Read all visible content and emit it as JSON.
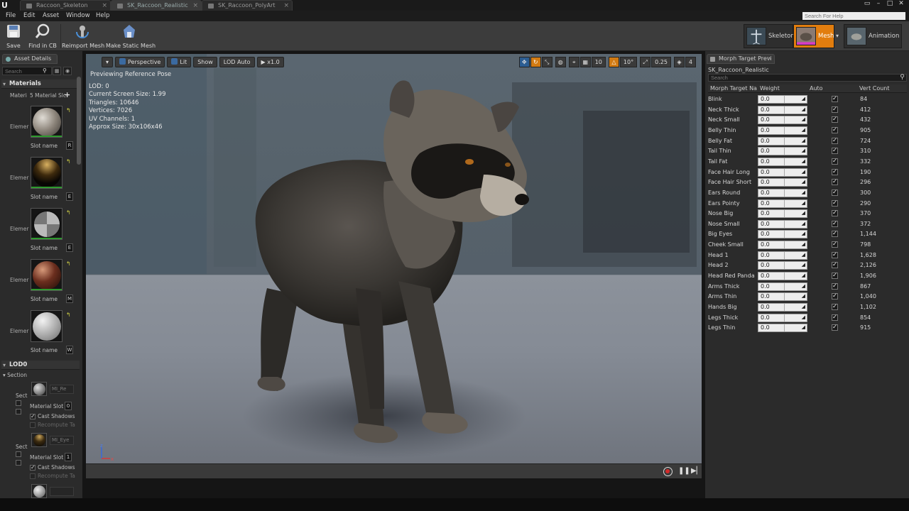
{
  "tabs": [
    {
      "label": "Raccoon_Skeleton",
      "active": false
    },
    {
      "label": "SK_Raccoon_Realistic",
      "active": true
    },
    {
      "label": "SK_Raccoon_PolyArt",
      "active": false
    }
  ],
  "menu": {
    "items": [
      "File",
      "Edit",
      "Asset",
      "Window",
      "Help"
    ],
    "help_search_placeholder": "Search For Help"
  },
  "toolbar": {
    "buttons": [
      {
        "label": "Save",
        "icon": "save-icon"
      },
      {
        "label": "Find in CB",
        "icon": "magnifier-icon"
      },
      {
        "label": "Reimport Mesh",
        "icon": "reimport-icon"
      },
      {
        "label": "Make Static Mesh",
        "icon": "static-mesh-icon"
      }
    ],
    "modes": [
      {
        "label": "Skeleton",
        "active": false
      },
      {
        "label": "Mesh",
        "active": true
      },
      {
        "label": "Animation",
        "active": false
      }
    ]
  },
  "asset_details": {
    "tab_label": "Asset Details",
    "search_placeholder": "Search",
    "materials_header": "Materials",
    "material_slots_label": "Materi",
    "material_slots_count": "5 Material Slc",
    "element_label": "Elemer",
    "slot_name_label": "Slot name",
    "slot_values": [
      "R",
      "E",
      "E",
      "M",
      "W"
    ],
    "lod_header": "LOD0",
    "sections_header": "Section",
    "section_label": "Sect",
    "material_slot_label": "Material Slot",
    "cast_shadows_label": "Cast Shadows",
    "recompute_label": "Recompute Ta",
    "section_materials": [
      "MI_Re",
      "MI_Eye"
    ],
    "section_slot_values": [
      "0",
      "1"
    ]
  },
  "viewport": {
    "buttons": {
      "perspective": "Perspective",
      "lit": "Lit",
      "show": "Show",
      "lod": "LOD Auto",
      "speed": "x1.0"
    },
    "right_values": {
      "grid": "10",
      "angle": "10°",
      "scale": "0.25",
      "cam": "4"
    },
    "title": "Previewing Reference Pose",
    "stats": {
      "lod": "LOD: 0",
      "screen_size": "Current Screen Size: 1.99",
      "triangles": "Triangles: 10646",
      "vertices": "Vertices: 7026",
      "uv_channels": "UV Channels: 1",
      "approx_size": "Approx Size: 30x106x46"
    }
  },
  "morph_panel": {
    "tab_label": "Morph Target Previ",
    "asset_name": "SK_Raccoon_Realistic",
    "search_placeholder": "Search",
    "headers": {
      "name": "Morph Target Nam",
      "weight": "Weight",
      "auto": "Auto",
      "vert_count": "Vert Count"
    },
    "rows": [
      {
        "name": "Blink",
        "weight": "0.0",
        "vert_count": "84"
      },
      {
        "name": "Neck Thick",
        "weight": "0.0",
        "vert_count": "412"
      },
      {
        "name": "Neck Small",
        "weight": "0.0",
        "vert_count": "432"
      },
      {
        "name": "Belly Thin",
        "weight": "0.0",
        "vert_count": "905"
      },
      {
        "name": "Belly Fat",
        "weight": "0.0",
        "vert_count": "724"
      },
      {
        "name": "Tail Thin",
        "weight": "0.0",
        "vert_count": "310"
      },
      {
        "name": "Tail Fat",
        "weight": "0.0",
        "vert_count": "332"
      },
      {
        "name": "Face Hair Long",
        "weight": "0.0",
        "vert_count": "190"
      },
      {
        "name": "Face Hair Short",
        "weight": "0.0",
        "vert_count": "296"
      },
      {
        "name": "Ears Round",
        "weight": "0.0",
        "vert_count": "300"
      },
      {
        "name": "Ears Pointy",
        "weight": "0.0",
        "vert_count": "290"
      },
      {
        "name": "Nose Big",
        "weight": "0.0",
        "vert_count": "370"
      },
      {
        "name": "Nose Small",
        "weight": "0.0",
        "vert_count": "372"
      },
      {
        "name": "Big Eyes",
        "weight": "0.0",
        "vert_count": "1,144"
      },
      {
        "name": "Cheek Small",
        "weight": "0.0",
        "vert_count": "798"
      },
      {
        "name": "Head 1",
        "weight": "0.0",
        "vert_count": "1,628"
      },
      {
        "name": "Head 2",
        "weight": "0.0",
        "vert_count": "2,126"
      },
      {
        "name": "Head Red Panda",
        "weight": "0.0",
        "vert_count": "1,906"
      },
      {
        "name": "Arms Thick",
        "weight": "0.0",
        "vert_count": "867"
      },
      {
        "name": "Arms Thin",
        "weight": "0.0",
        "vert_count": "1,040"
      },
      {
        "name": "Hands Big",
        "weight": "0.0",
        "vert_count": "1,102"
      },
      {
        "name": "Legs Thick",
        "weight": "0.0",
        "vert_count": "854"
      },
      {
        "name": "Legs Thin",
        "weight": "0.0",
        "vert_count": "915"
      }
    ]
  },
  "colors": {
    "accent": "#e27d0e",
    "record": "#d42a2a",
    "panel": "#2b2b2b"
  }
}
